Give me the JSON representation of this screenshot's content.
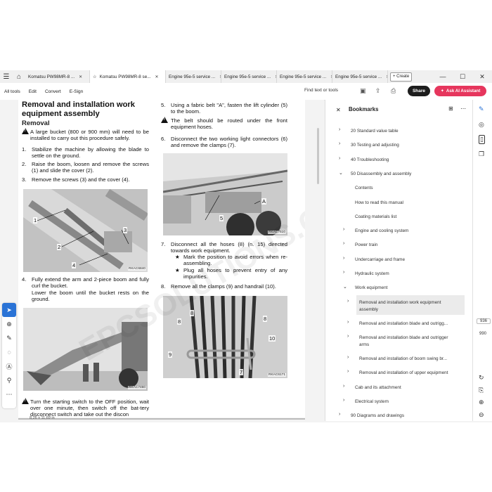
{
  "tabs": [
    {
      "label": "Komatsu PW98MR-8 ...",
      "active": false
    },
    {
      "label": "Komatsu PW98MR-8 se...",
      "active": true
    },
    {
      "label": "Engine 95e-5 service ...",
      "active": false
    },
    {
      "label": "Engine 95e-5 service ...",
      "active": false
    },
    {
      "label": "Engine 95e-5 service ...",
      "active": false
    },
    {
      "label": "Engine 95e-5 service ...",
      "active": false
    }
  ],
  "create_label": "+ Create",
  "toolbar": {
    "menu": [
      "All tools",
      "Edit",
      "Convert",
      "E-Sign"
    ],
    "find_label": "Find text or tools",
    "share_label": "Share",
    "ask_ai_label": "Ask AI Assistant"
  },
  "document": {
    "heading": "Removal and installation work equipment assembly",
    "subheading": "Removal",
    "warning1": "A large bucket (800 or 900 mm) will need to be installed to carry out this procedure safely.",
    "steps_left": [
      {
        "n": "1.",
        "text": "Stabilize the machine by allowing the blade to settle on the ground."
      },
      {
        "n": "2.",
        "text": "Raise the boom, loosen and remove the screws (1) and slide the cover (2)."
      },
      {
        "n": "3.",
        "text": "Remove the screws (3) and the cover (4)."
      }
    ],
    "step4": {
      "n": "4.",
      "text": "Fully extend the arm and 2-piece boom and fully curl the bucket.",
      "text2": "Lower the boom until the bucket rests on the ground."
    },
    "warning_bottom": "Turn the starting switch to the OFF position, wait over one minute, then switch off the bat-tery disconnect switch and take out the discon",
    "step5": {
      "n": "5.",
      "text": "Using a fabric belt \"A\", fasten the lift cylinder (5) to the boom."
    },
    "warning2": "The belt should be routed under the front equipment hoses.",
    "step6": {
      "n": "6.",
      "text": "Disconnect the two working light connectors (6) and remove the clamps (7)."
    },
    "step7": {
      "n": "7.",
      "text": "Disconnect all the hoses (8) (n. 15) directed towards work equipment."
    },
    "bullets": [
      "Mark the position to avoid errors when re-assembling.",
      "Plug all hoses to prevent entry of any impurities."
    ],
    "step8": {
      "n": "8.",
      "text": "Remove all the clamps (9) and handrail (10)."
    },
    "fig1": {
      "id": "RKAC6840",
      "labels": [
        "1",
        "2",
        "3",
        "4"
      ]
    },
    "fig2": {
      "id": "RKAC7460"
    },
    "fig3": {
      "id": "RKAC7510",
      "labels": [
        "A",
        "5"
      ]
    },
    "fig4": {
      "id": "RKAC6171",
      "labels": [
        "8",
        "8",
        "8",
        "9",
        "10",
        "7"
      ]
    },
    "watermark": "EPCSOLUTIONS.COM",
    "page_size": "8,26 x 11,69 in"
  },
  "bookmarks": {
    "title": "Bookmarks",
    "items": [
      {
        "label": "20 Standard value table",
        "chev": "›",
        "level": 0
      },
      {
        "label": "30 Testing and adjusting",
        "chev": "›",
        "level": 0
      },
      {
        "label": "40 Troubleshooting",
        "chev": "›",
        "level": 0
      },
      {
        "label": "50 Disassembly and assembly",
        "chev": "⌄",
        "level": 0
      },
      {
        "label": "Contents",
        "chev": "",
        "level": 1
      },
      {
        "label": "How to read this manual",
        "chev": "",
        "level": 1
      },
      {
        "label": "Coating materials list",
        "chev": "",
        "level": 1
      },
      {
        "label": "Engine and cooling system",
        "chev": "›",
        "level": 1
      },
      {
        "label": "Power train",
        "chev": "›",
        "level": 1
      },
      {
        "label": "Undercarriage and frame",
        "chev": "›",
        "level": 1
      },
      {
        "label": "Hydraulic system",
        "chev": "›",
        "level": 1
      },
      {
        "label": "Work equipment",
        "chev": "⌄",
        "level": 1
      },
      {
        "label": "Removal and installation work equipment",
        "label2": "assembly",
        "chev": "›",
        "level": 2,
        "selected": true
      },
      {
        "label": "Removal and installation blade and outrigg...",
        "chev": "›",
        "level": 2
      },
      {
        "label": "Removal and installation blade and outrigger",
        "label2": "arms",
        "chev": "›",
        "level": 2
      },
      {
        "label": "Removal and installation of boom swing br...",
        "chev": "›",
        "level": 2
      },
      {
        "label": "Removal and installation of upper equipment",
        "chev": "›",
        "level": 2
      },
      {
        "label": "Cab and its attachment",
        "chev": "›",
        "level": 1
      },
      {
        "label": "Electrical system",
        "chev": "›",
        "level": 1
      },
      {
        "label": "90 Diagrams and drawings",
        "chev": "›",
        "level": 0
      }
    ]
  },
  "page_current": "936",
  "page_total": "990"
}
